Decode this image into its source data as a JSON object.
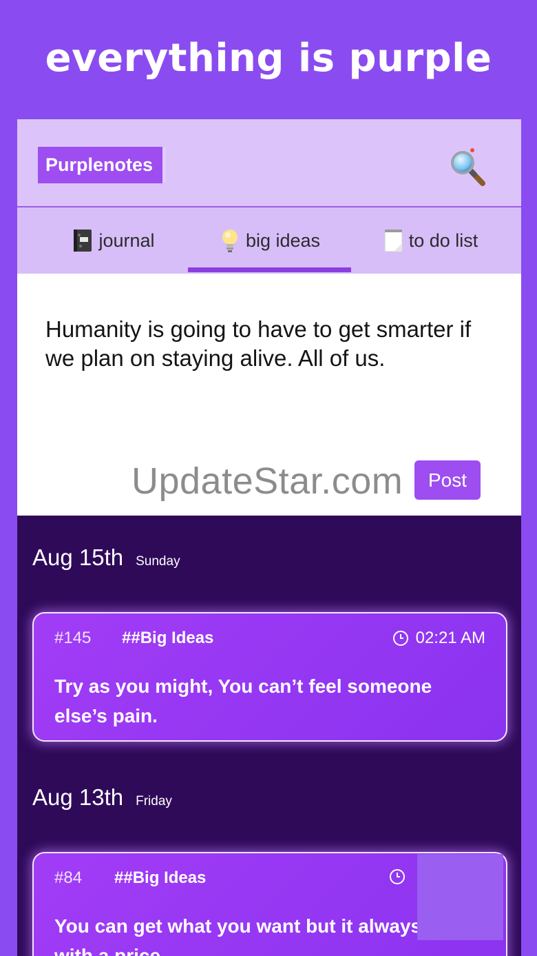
{
  "headline": "everything is purple",
  "app": {
    "name": "Purplenotes",
    "search_icon": "magnifier-icon"
  },
  "tabs": [
    {
      "label": "journal",
      "icon": "notebook-icon",
      "active": false
    },
    {
      "label": "big ideas",
      "icon": "lightbulb-icon",
      "active": true
    },
    {
      "label": "to do list",
      "icon": "notepad-icon",
      "active": false
    }
  ],
  "compose": {
    "text": "Humanity is going to have to get smarter if we plan on staying alive. All of us.",
    "watermark": "UpdateStar.com",
    "post_label": "Post"
  },
  "days": [
    {
      "date": "Aug 15th",
      "weekday": "Sunday",
      "entry": {
        "number": "#145",
        "tag": "##Big Ideas",
        "time": "02:21 AM",
        "text": "Try as you might, You can’t feel someone else’s pain."
      }
    },
    {
      "date": "Aug 13th",
      "weekday": "Friday",
      "entry": {
        "number": "#84",
        "tag": "##Big Ideas",
        "time": "",
        "text": "You can get what you want but it always comes with a price."
      }
    }
  ],
  "colors": {
    "background": "#8a4cf0",
    "appbar": "#dcc4fb",
    "accent": "#9d4df0",
    "feed": "#2f0a59"
  }
}
